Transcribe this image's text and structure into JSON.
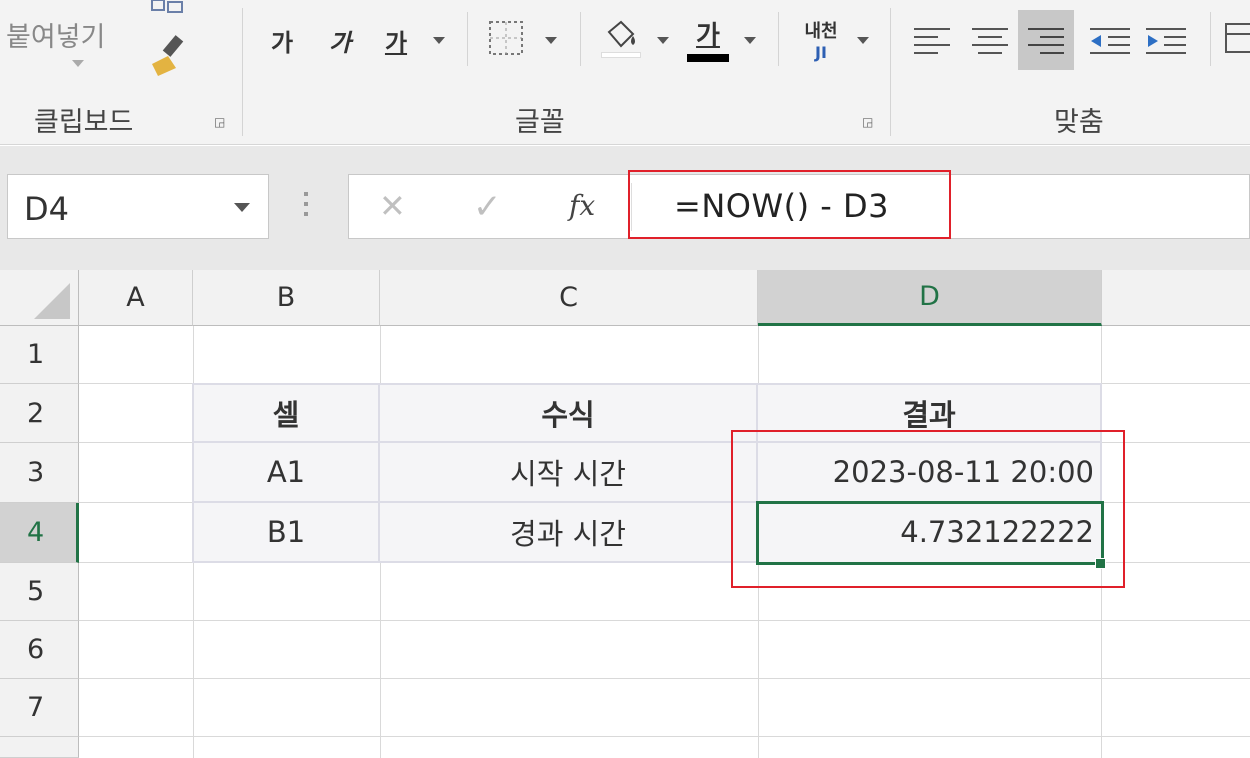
{
  "ribbon": {
    "clipboard": {
      "paste_label": "붙여넣기",
      "group_label": "클립보드"
    },
    "font": {
      "bold": "가",
      "italic": "가",
      "underline": "가",
      "font_color": "가",
      "group_label": "글꼴"
    },
    "align": {
      "wrap_label_top": "내천",
      "wrap_label_bottom": "JI",
      "group_label": "맞춤"
    }
  },
  "formula_bar": {
    "name_box": "D4",
    "cancel": "✕",
    "enter": "✓",
    "fx": "fx",
    "formula": "=NOW() - D3"
  },
  "grid": {
    "columns": [
      "A",
      "B",
      "C",
      "D"
    ],
    "rows": [
      "1",
      "2",
      "3",
      "4",
      "5",
      "6",
      "7"
    ],
    "table": {
      "header": [
        "셀",
        "수식",
        "결과"
      ],
      "row1": [
        "A1",
        "시작 시간",
        "2023-08-11 20:00"
      ],
      "row2": [
        "B1",
        "경과 시간",
        "4.732122222"
      ]
    },
    "active_cell": "D4"
  },
  "colors": {
    "accent_green": "#217346",
    "highlight_red": "#e0202a"
  }
}
